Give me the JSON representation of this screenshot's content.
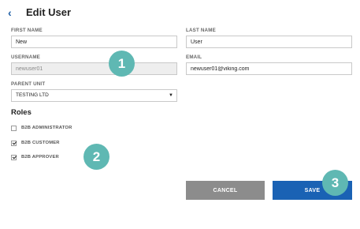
{
  "header": {
    "back_icon": "chevron-left-icon",
    "title": "Edit User"
  },
  "form": {
    "first_name": {
      "label": "FIRST NAME",
      "value": "New"
    },
    "last_name": {
      "label": "LAST NAME",
      "value": "User"
    },
    "username": {
      "label": "USERNAME",
      "value": "newuser01"
    },
    "email": {
      "label": "EMAIL",
      "value": "newuser01@viking.com"
    },
    "parent_unit": {
      "label": "PARENT UNIT",
      "value": "TESTING LTD"
    }
  },
  "roles": {
    "title": "Roles",
    "items": [
      {
        "label": "B2B ADMINISTRATOR",
        "checked": false
      },
      {
        "label": "B2B CUSTOMER",
        "checked": true
      },
      {
        "label": "B2B APPROVER",
        "checked": true
      }
    ]
  },
  "actions": {
    "cancel_label": "CANCEL",
    "save_label": "SAVE"
  },
  "callouts": [
    "1",
    "2",
    "3"
  ],
  "colors": {
    "accent": "#1a62b4",
    "badge": "#5fb8b3",
    "cancel": "#8c8c8c"
  }
}
